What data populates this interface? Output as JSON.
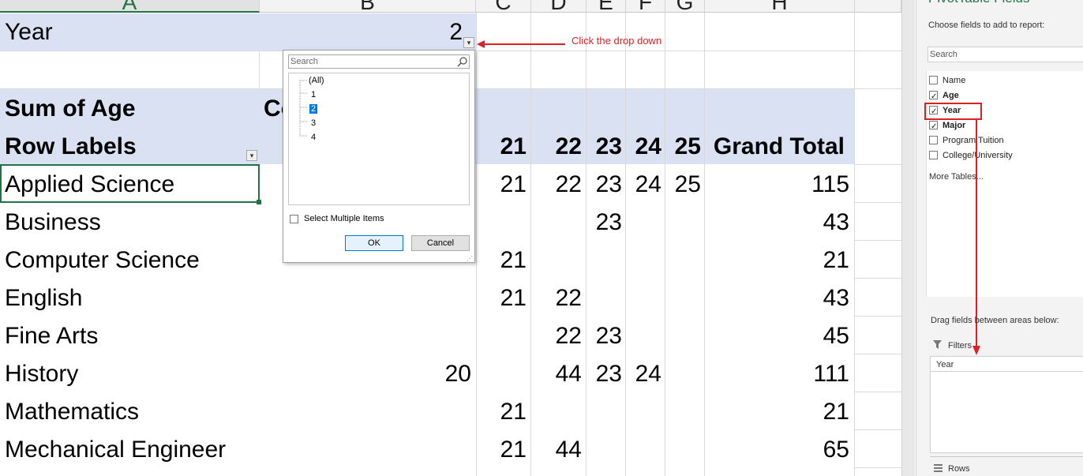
{
  "columns": [
    "A",
    "B",
    "C",
    "D",
    "E",
    "F",
    "G",
    "H"
  ],
  "filter": {
    "label": "Year",
    "value": "2"
  },
  "pivot": {
    "sum_label": "Sum of Age",
    "col_label_partial": "Co",
    "row_labels": "Row Labels",
    "col_headers": [
      "21",
      "22",
      "23",
      "24",
      "25",
      "Grand Total"
    ],
    "rows": [
      {
        "label": "Applied Science",
        "b": "",
        "v21": "21",
        "v22": "22",
        "v23": "23",
        "v24": "24",
        "v25": "25",
        "total": "115"
      },
      {
        "label": "Business",
        "b": "",
        "v21": "",
        "v22": "",
        "v23": "23",
        "v24": "",
        "v25": "",
        "total": "43"
      },
      {
        "label": "Computer Science",
        "b": "",
        "v21": "21",
        "v22": "",
        "v23": "",
        "v24": "",
        "v25": "",
        "total": "21"
      },
      {
        "label": "English",
        "b": "",
        "v21": "21",
        "v22": "22",
        "v23": "",
        "v24": "",
        "v25": "",
        "total": "43"
      },
      {
        "label": "Fine Arts",
        "b": "",
        "v21": "",
        "v22": "22",
        "v23": "23",
        "v24": "",
        "v25": "",
        "total": "45"
      },
      {
        "label": "History",
        "b": "20",
        "v21": "",
        "v22": "44",
        "v23": "23",
        "v24": "24",
        "v25": "",
        "total": "111"
      },
      {
        "label": "Mathematics",
        "b": "",
        "v21": "21",
        "v22": "",
        "v23": "",
        "v24": "",
        "v25": "",
        "total": "21"
      },
      {
        "label": "Mechanical Engineer",
        "b": "",
        "v21": "21",
        "v22": "44",
        "v23": "",
        "v24": "",
        "v25": "",
        "total": "65"
      }
    ]
  },
  "dropdown": {
    "search_placeholder": "Search",
    "items": [
      "(All)",
      "1",
      "2",
      "3",
      "4"
    ],
    "selected": "2",
    "multi_label": "Select Multiple Items",
    "ok_label": "OK",
    "cancel_label": "Cancel"
  },
  "annotation": {
    "text": "Click the drop down",
    "color": "#e02020"
  },
  "panel": {
    "title": "PivotTable Fields",
    "choose_label": "Choose fields to add to report:",
    "search_placeholder": "Search",
    "fields": [
      {
        "name": "Name",
        "checked": false,
        "bold": false
      },
      {
        "name": "Age",
        "checked": true,
        "bold": true
      },
      {
        "name": "Year",
        "checked": true,
        "bold": true
      },
      {
        "name": "Major",
        "checked": true,
        "bold": true
      },
      {
        "name": "Program Tuition",
        "checked": false,
        "bold": false
      },
      {
        "name": "College/University",
        "checked": false,
        "bold": false
      }
    ],
    "more_tables": "More Tables...",
    "drag_label": "Drag fields between areas below:",
    "filters_label": "Filters",
    "filters_item": "Year",
    "rows_label": "Rows"
  },
  "colors": {
    "header_band": "#d9e1f2",
    "accent_green": "#217346",
    "annotation_red": "#e02020"
  }
}
